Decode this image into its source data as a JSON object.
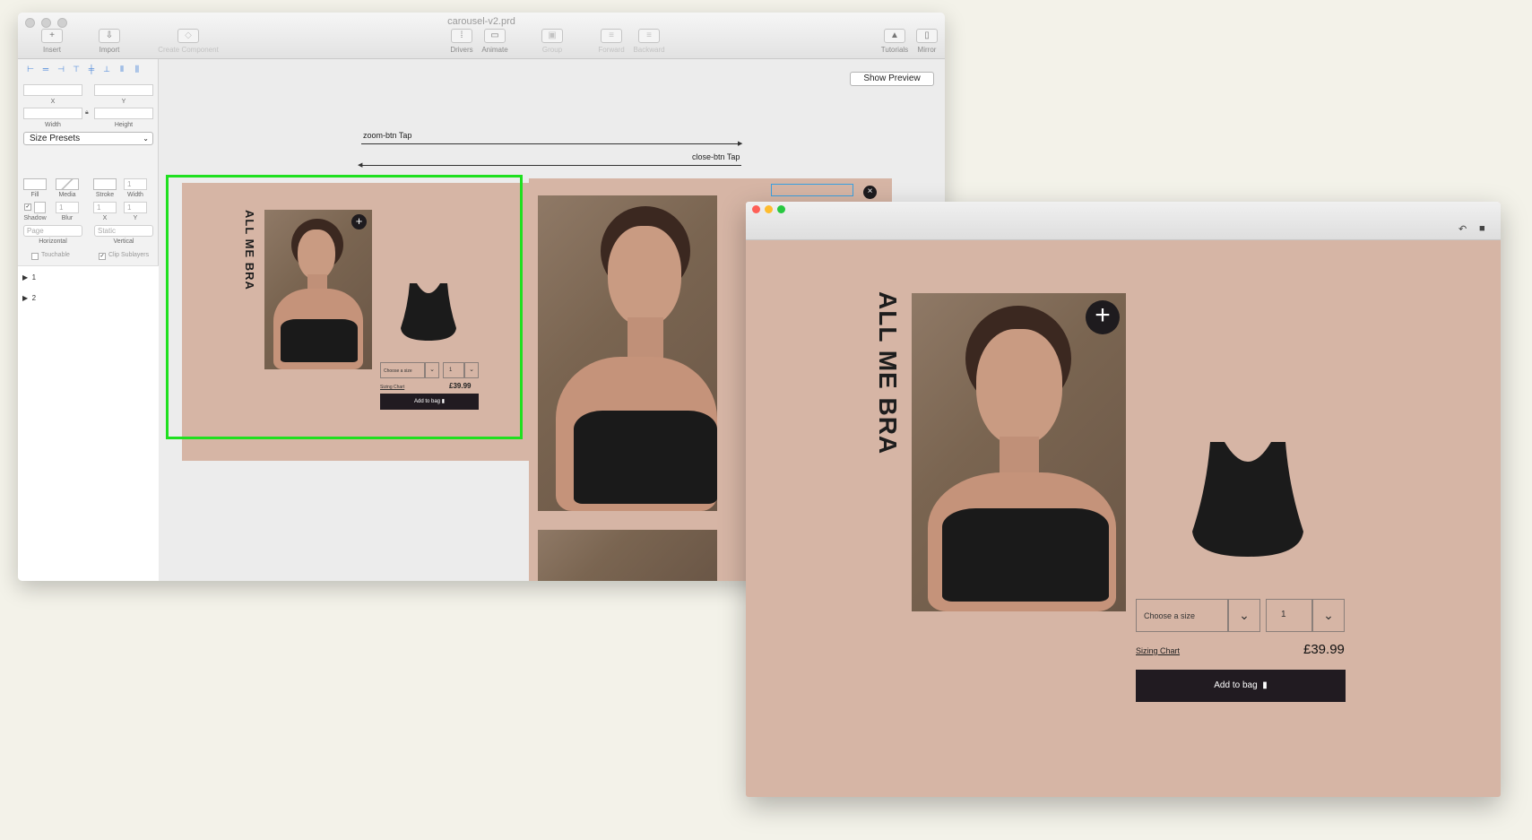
{
  "editor": {
    "title": "carousel-v2.prd",
    "toolbar": [
      {
        "label": "Insert",
        "icon": "plus-icon",
        "glyph": "+",
        "enabled": true
      },
      {
        "label": "Import",
        "icon": "import-icon",
        "glyph": "⇩",
        "enabled": true
      },
      {
        "label": "Create Component",
        "icon": "component-icon",
        "glyph": "◇",
        "enabled": false
      },
      {
        "label": "Drivers",
        "icon": "drivers-icon",
        "glyph": "⁞",
        "enabled": true
      },
      {
        "label": "Animate",
        "icon": "animate-icon",
        "glyph": "▭",
        "enabled": true
      },
      {
        "label": "Group",
        "icon": "group-icon",
        "glyph": "▣",
        "enabled": false
      },
      {
        "label": "Forward",
        "icon": "forward-icon",
        "glyph": "≡",
        "enabled": false
      },
      {
        "label": "Backward",
        "icon": "backward-icon",
        "glyph": "≡",
        "enabled": false
      },
      {
        "label": "Tutorials",
        "icon": "tutorials-icon",
        "glyph": "▲",
        "enabled": true
      },
      {
        "label": "Mirror",
        "icon": "mirror-icon",
        "glyph": "▯",
        "enabled": true
      }
    ],
    "inspector": {
      "x_label": "X",
      "y_label": "Y",
      "width_label": "Width",
      "height_label": "Height",
      "size_presets": "Size Presets",
      "fill_label": "Fill",
      "media_label": "Media",
      "stroke_label": "Stroke",
      "stroke_width_label": "Width",
      "stroke_width_value": "1",
      "shadow_label": "Shadow",
      "blur_label": "Blur",
      "blur_value": "1",
      "shadow_x_label": "X",
      "shadow_x_value": "1",
      "shadow_y_label": "Y",
      "shadow_y_value": "1",
      "horizontal_value": "Page",
      "horizontal_label": "Horizontal",
      "vertical_value": "Static",
      "vertical_label": "Vertical",
      "touchable_label": "Touchable",
      "clip_sublayers_label": "Clip Sublayers"
    },
    "layers": [
      "1",
      "2"
    ],
    "show_preview": "Show Preview",
    "connections": [
      {
        "label": "zoom-btn Tap",
        "direction": "right"
      },
      {
        "label": "close-btn Tap",
        "direction": "left"
      }
    ]
  },
  "product": {
    "title": "ALL ME BRA",
    "size_placeholder": "Choose a size",
    "quantity": "1",
    "sizing_chart": "Sizing Chart",
    "price": "£39.99",
    "add_to_bag": "Add to bag",
    "background_color": "#d6b5a5",
    "button_color": "#211b21"
  },
  "preview_window": {
    "undo_icon": "undo-icon",
    "record_icon": "video-camera-icon"
  }
}
